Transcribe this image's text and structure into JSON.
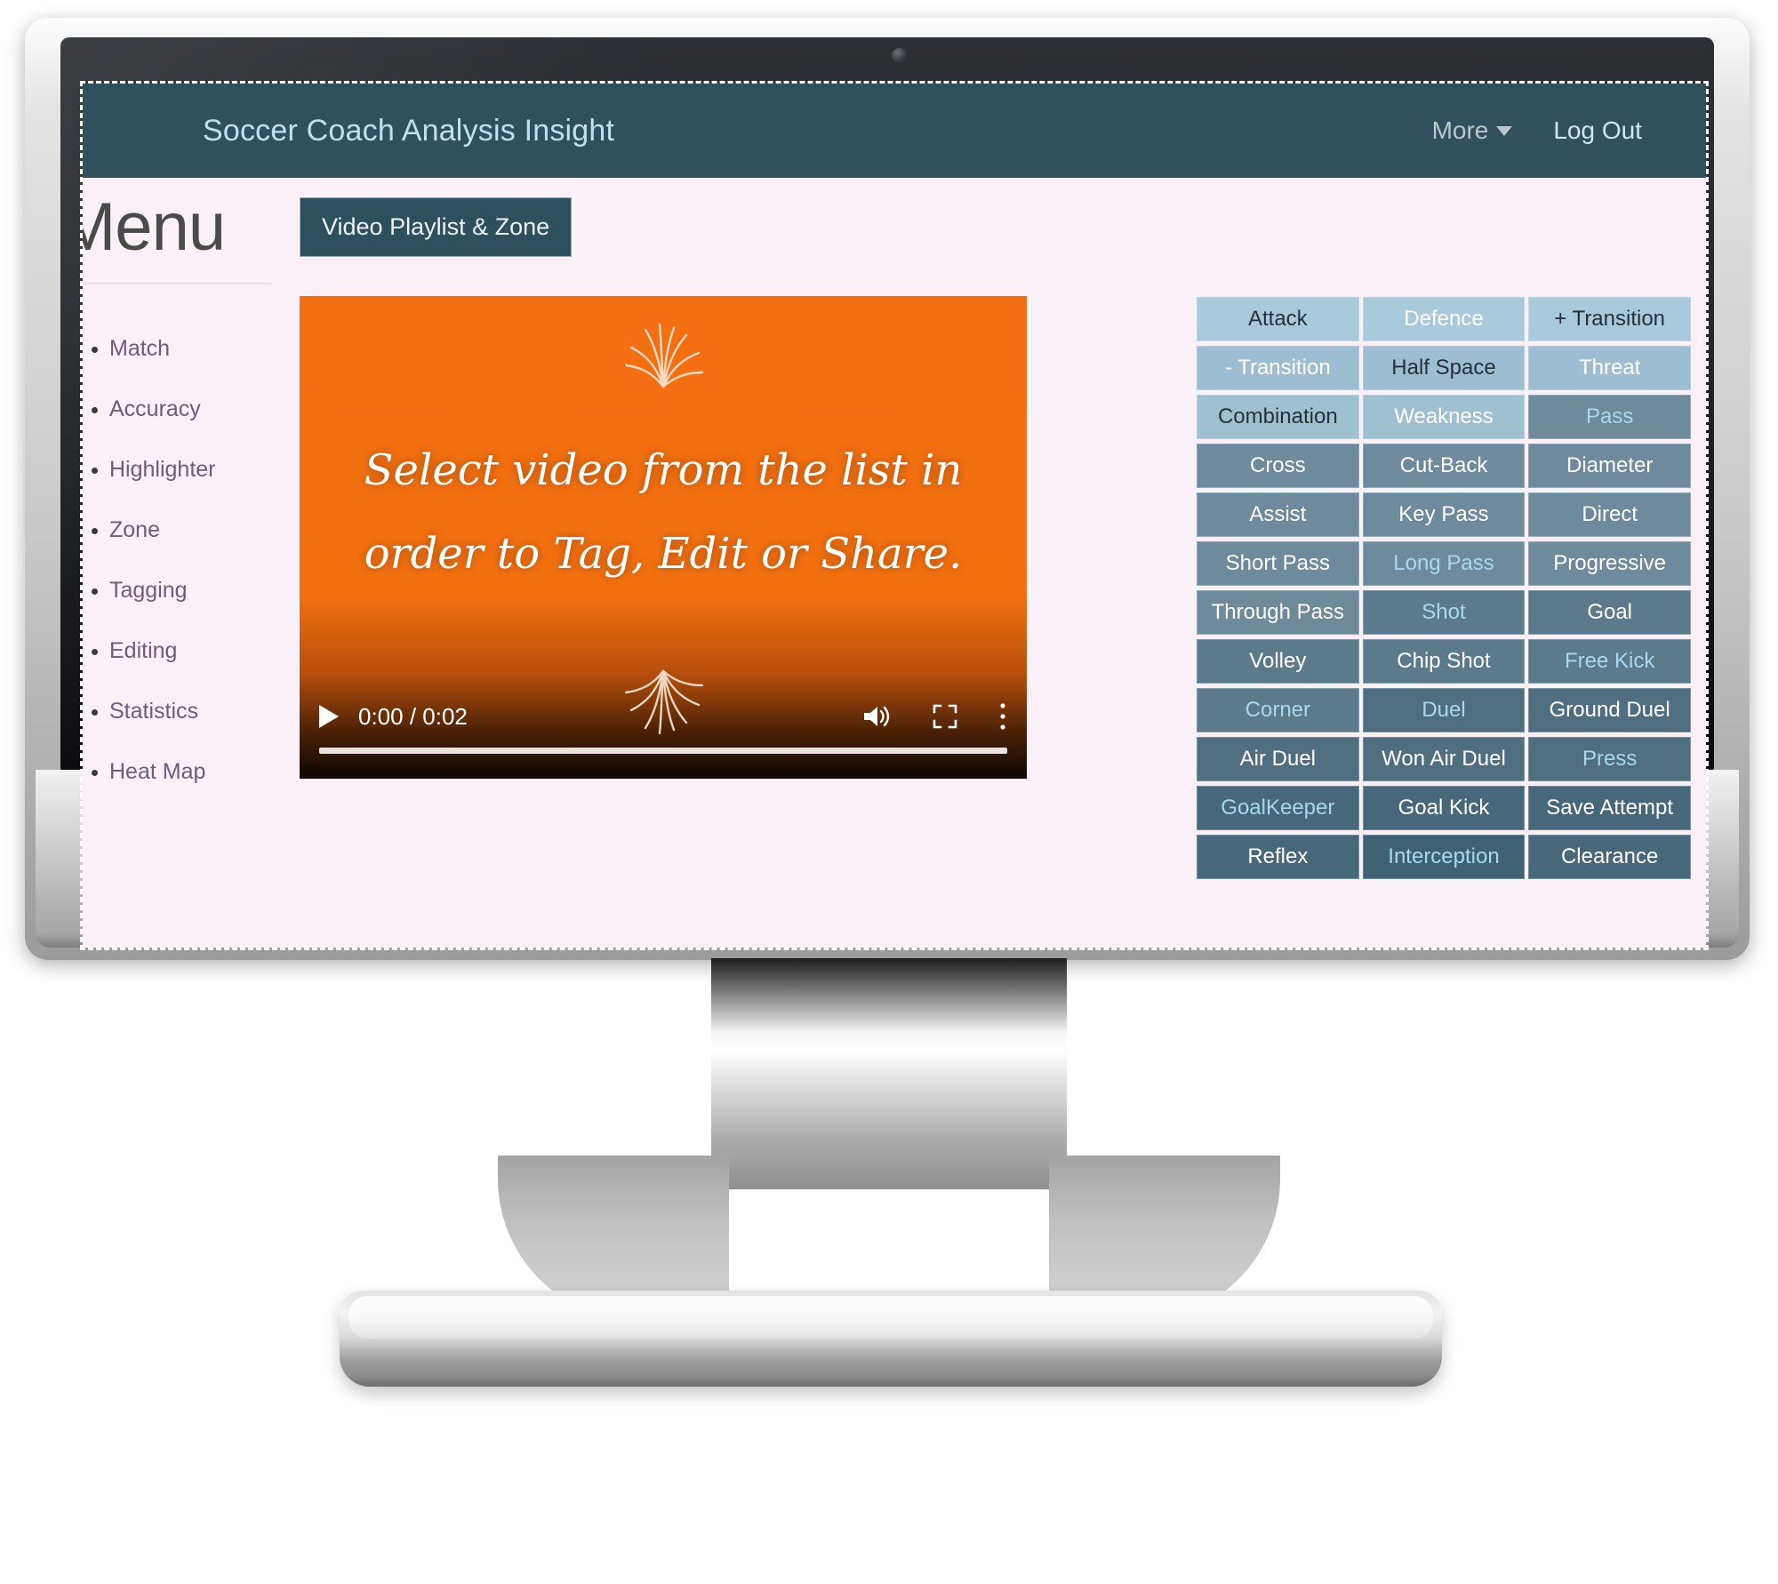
{
  "app": {
    "brand": "Soccer Coach Analysis Insight",
    "nav": {
      "more_label": "More",
      "logout_label": "Log Out"
    },
    "colors": {
      "navbar_bg": "#31505e",
      "page_bg": "#f9f1f7",
      "brand_text": "#bfe0ef",
      "button_bg": "#2e4f5e",
      "video_bg": "#f36f12",
      "tag_light": "#a9c9dc",
      "tag_dark": "#4c6b7b"
    }
  },
  "sidebar": {
    "title": "Menu",
    "items": [
      {
        "label": "Match"
      },
      {
        "label": "Accuracy"
      },
      {
        "label": "Highlighter"
      },
      {
        "label": "Zone"
      },
      {
        "label": "Tagging"
      },
      {
        "label": "Editing"
      },
      {
        "label": "Statistics"
      },
      {
        "label": "Heat Map"
      }
    ]
  },
  "toolbar": {
    "playlist_button": "Video Playlist & Zone"
  },
  "video": {
    "caption_line1": "Select video from the list  in",
    "caption_line2": "order to Tag, Edit or Share.",
    "time_display": "0:00 / 0:02",
    "current_time": "0:00",
    "duration": "0:02",
    "progress_percent": 0,
    "controls": {
      "play_icon": "play-icon",
      "volume_icon": "volume-icon",
      "fullscreen_icon": "fullscreen-icon",
      "more_options_icon": "kebab-menu-icon"
    }
  },
  "tag_grid": {
    "columns": 3,
    "cells": [
      {
        "label": "Attack",
        "tone": "l1",
        "text": "dark"
      },
      {
        "label": "Defence",
        "tone": "l1",
        "text": "light"
      },
      {
        "label": "+ Transition",
        "tone": "l1",
        "text": "dark"
      },
      {
        "label": "- Transition",
        "tone": "l2",
        "text": "light"
      },
      {
        "label": "Half Space",
        "tone": "l2",
        "text": "dark"
      },
      {
        "label": "Threat",
        "tone": "l2",
        "text": "light"
      },
      {
        "label": "Combination",
        "tone": "l3",
        "text": "dark"
      },
      {
        "label": "Weakness",
        "tone": "l3",
        "text": "light"
      },
      {
        "label": "Pass",
        "tone": "l4",
        "text": "blue"
      },
      {
        "label": "Cross",
        "tone": "l5",
        "text": "light"
      },
      {
        "label": "Cut-Back",
        "tone": "l5",
        "text": "light"
      },
      {
        "label": "Diameter",
        "tone": "l5",
        "text": "light"
      },
      {
        "label": "Assist",
        "tone": "l5",
        "text": "light"
      },
      {
        "label": "Key Pass",
        "tone": "l5",
        "text": "light"
      },
      {
        "label": "Direct",
        "tone": "l5",
        "text": "light"
      },
      {
        "label": "Short Pass",
        "tone": "l5",
        "text": "light"
      },
      {
        "label": "Long Pass",
        "tone": "l5",
        "text": "blue"
      },
      {
        "label": "Progressive",
        "tone": "l5",
        "text": "light"
      },
      {
        "label": "Through Pass",
        "tone": "l4",
        "text": "light"
      },
      {
        "label": "Shot",
        "tone": "l6",
        "text": "blue"
      },
      {
        "label": "Goal",
        "tone": "l6",
        "text": "light"
      },
      {
        "label": "Volley",
        "tone": "l6",
        "text": "light"
      },
      {
        "label": "Chip Shot",
        "tone": "l6",
        "text": "light"
      },
      {
        "label": "Free Kick",
        "tone": "l6",
        "text": "blue"
      },
      {
        "label": "Corner",
        "tone": "l6",
        "text": "blue"
      },
      {
        "label": "Duel",
        "tone": "l7",
        "text": "blue"
      },
      {
        "label": "Ground Duel",
        "tone": "l7",
        "text": "light"
      },
      {
        "label": "Air Duel",
        "tone": "l7",
        "text": "light"
      },
      {
        "label": "Won Air Duel",
        "tone": "l7",
        "text": "light"
      },
      {
        "label": "Press",
        "tone": "l7",
        "text": "blue"
      },
      {
        "label": "GoalKeeper",
        "tone": "l8",
        "text": "blue"
      },
      {
        "label": "Goal Kick",
        "tone": "l8",
        "text": "light"
      },
      {
        "label": "Save Attempt",
        "tone": "l8",
        "text": "light"
      },
      {
        "label": "Reflex",
        "tone": "l8",
        "text": "light"
      },
      {
        "label": "Interception",
        "tone": "l9",
        "text": "blue"
      },
      {
        "label": "Clearance",
        "tone": "l8",
        "text": "light"
      }
    ]
  }
}
